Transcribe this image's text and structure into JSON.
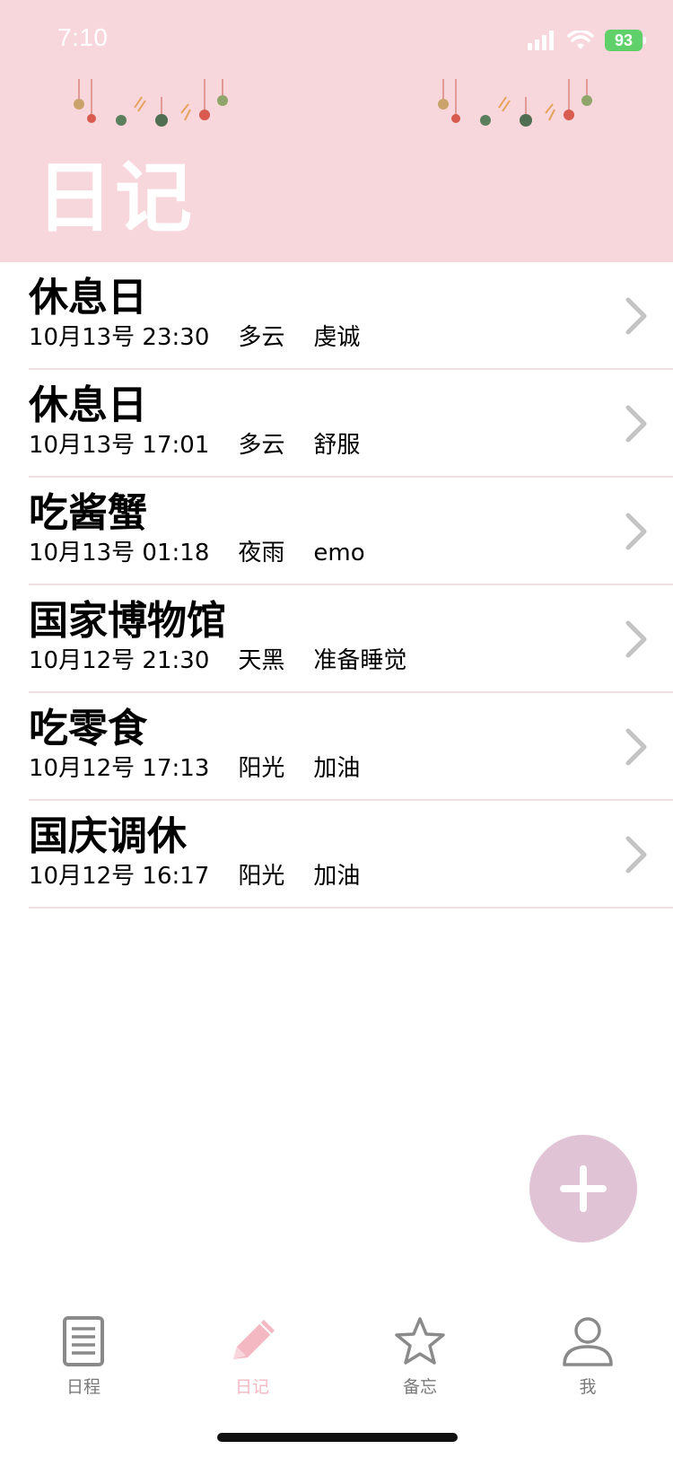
{
  "status_bar": {
    "time": "7:10",
    "battery": "93"
  },
  "header": {
    "title": "日记"
  },
  "entries": [
    {
      "title": "休息日",
      "datetime": "10月13号 23:30",
      "weather": "多云",
      "mood": "虔诚"
    },
    {
      "title": "休息日",
      "datetime": "10月13号 17:01",
      "weather": "多云",
      "mood": "舒服"
    },
    {
      "title": "吃酱蟹",
      "datetime": "10月13号 01:18",
      "weather": "夜雨",
      "mood": "emo"
    },
    {
      "title": "国家博物馆",
      "datetime": "10月12号 21:30",
      "weather": "天黑",
      "mood": "准备睡觉"
    },
    {
      "title": "吃零食",
      "datetime": "10月12号 17:13",
      "weather": "阳光",
      "mood": "加油"
    },
    {
      "title": "国庆调休",
      "datetime": "10月12号 16:17",
      "weather": "阳光",
      "mood": "加油"
    }
  ],
  "tabs": [
    {
      "label": "日程",
      "icon": "document-icon",
      "active": false
    },
    {
      "label": "日记",
      "icon": "pencil-icon",
      "active": true
    },
    {
      "label": "备忘",
      "icon": "star-icon",
      "active": false
    },
    {
      "label": "我",
      "icon": "person-icon",
      "active": false
    }
  ],
  "colors": {
    "header_bg": "#f8d7dc",
    "accent_pink": "#f3b8c2",
    "fab_bg": "#e0c4d5",
    "divider": "#f1dfe2",
    "battery": "#5fd06a"
  }
}
